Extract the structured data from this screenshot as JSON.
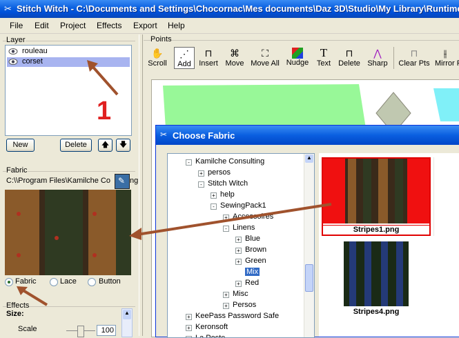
{
  "window": {
    "title": "Stitch Witch - C:\\Documents and Settings\\Chocornac\\Mes documents\\Daz 3D\\Studio\\My Library\\Runtime\\"
  },
  "menu": [
    "File",
    "Edit",
    "Project",
    "Effects",
    "Export",
    "Help"
  ],
  "layer_panel": {
    "group_label": "Layer",
    "layers": [
      {
        "name": "rouleau",
        "selected": false
      },
      {
        "name": "corset",
        "selected": true
      }
    ],
    "new_label": "New",
    "delete_label": "Delete",
    "annotation_number": "1"
  },
  "fabric_panel": {
    "group_label": "Fabric",
    "path": "C:\\\\Program Files\\Kamilche Co",
    "path_tail": "ng",
    "radios": [
      {
        "label": "Fabric",
        "checked": true
      },
      {
        "label": "Lace",
        "checked": false
      },
      {
        "label": "Button",
        "checked": false
      }
    ]
  },
  "effects_panel": {
    "group_label": "Effects",
    "size_label": "Size:",
    "scale_label": "Scale",
    "scale_value": "100"
  },
  "points_panel": {
    "group_label": "Points",
    "tools": [
      "Scroll",
      "Add",
      "Insert",
      "Move",
      "Move All",
      "Nudge",
      "Text",
      "Delete",
      "Sharp",
      "Clear Pts",
      "Mirror F"
    ],
    "active_tool": "Add"
  },
  "dialog": {
    "title": "Choose Fabric",
    "tree": [
      {
        "label": "Kamilche Consulting",
        "level": 0,
        "expander": "-"
      },
      {
        "label": "persos",
        "level": 1,
        "expander": "+"
      },
      {
        "label": "Stitch Witch",
        "level": 1,
        "expander": "-"
      },
      {
        "label": "help",
        "level": 2,
        "expander": "+"
      },
      {
        "label": "SewingPack1",
        "level": 2,
        "expander": "-"
      },
      {
        "label": "Accessoires",
        "level": 3,
        "expander": "+"
      },
      {
        "label": "Linens",
        "level": 3,
        "expander": "-"
      },
      {
        "label": "Blue",
        "level": 4,
        "expander": "+"
      },
      {
        "label": "Brown",
        "level": 4,
        "expander": "+"
      },
      {
        "label": "Green",
        "level": 4,
        "expander": "+"
      },
      {
        "label": "Mix",
        "level": 4,
        "expander": "",
        "selected": true
      },
      {
        "label": "Red",
        "level": 4,
        "expander": "+"
      },
      {
        "label": "Misc",
        "level": 3,
        "expander": "+"
      },
      {
        "label": "Persos",
        "level": 3,
        "expander": "+"
      },
      {
        "label": "KeePass Password Safe",
        "level": -1,
        "expander": "+"
      },
      {
        "label": "Keronsoft",
        "level": -1,
        "expander": "+"
      },
      {
        "label": "La Poste",
        "level": -1,
        "expander": "+"
      }
    ],
    "thumbnails": [
      {
        "label": "Stripes1.png",
        "selected": true
      },
      {
        "label": "Stripes4.png",
        "selected": false
      }
    ]
  },
  "colors": {
    "xp_blue": "#0a5fe0",
    "selection": "#316ac5",
    "annotation_arrow": "#a0522d",
    "annotation_number": "#e02020",
    "canvas_green": "#98f898",
    "canvas_cyan": "#80f0f8"
  }
}
